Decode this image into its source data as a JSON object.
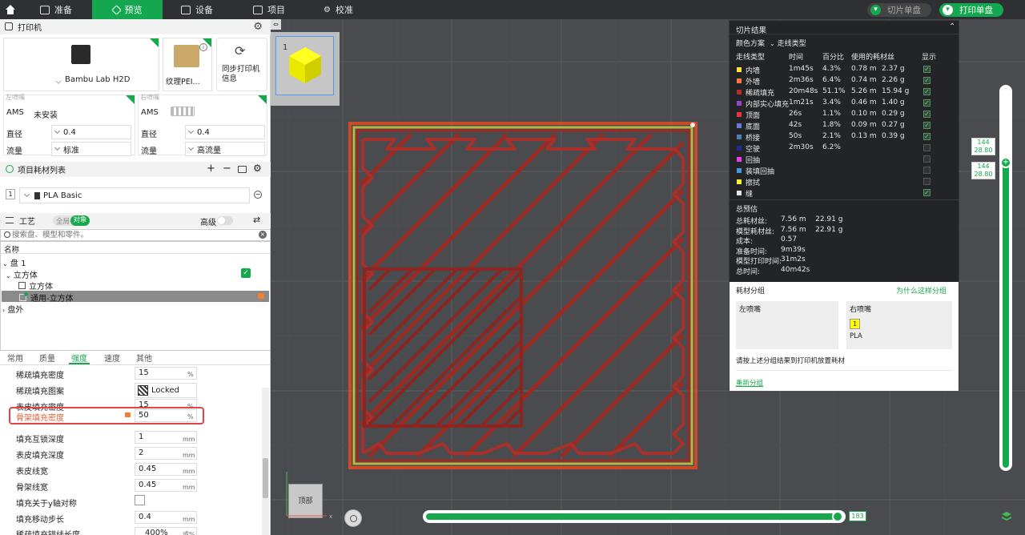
{
  "topbar": {
    "tabs": [
      {
        "label": "准备",
        "icon": "prepare-icon"
      },
      {
        "label": "预览",
        "icon": "preview-icon",
        "active": true
      },
      {
        "label": "设备",
        "icon": "device-icon"
      },
      {
        "label": "项目",
        "icon": "project-icon"
      },
      {
        "label": "校准",
        "icon": "calibrate-icon"
      }
    ],
    "slice_button": "切片单盘",
    "print_button": "打印单盘",
    "accent": "#15a750"
  },
  "printer": {
    "header": "打印机",
    "model": "Bambu Lab H2D",
    "plate": "纹理PEI...",
    "sync_label": "同步打印机信息",
    "left_nozzle_label": "左喷嘴",
    "right_nozzle_label": "右喷嘴",
    "left": {
      "ams_label": "AMS",
      "ams_value": "未安装",
      "diameter_label": "直径",
      "diameter": "0.4",
      "flow_label": "流量",
      "flow": "标准"
    },
    "right": {
      "ams_label": "AMS",
      "diameter_label": "直径",
      "diameter": "0.4",
      "flow_label": "流量",
      "flow": "高流量"
    }
  },
  "filaments": {
    "header": "项目耗材列表",
    "items": [
      {
        "index": "1",
        "name": "PLA Basic",
        "color": "#ffff00"
      }
    ]
  },
  "process": {
    "header": "工艺",
    "toggle_global": "全局",
    "toggle_object": "对象",
    "advanced_label": "高级",
    "search_placeholder": "搜索盘、模型和零件。",
    "tree_header": "名称",
    "tree": [
      {
        "label": "盘 1"
      },
      {
        "label": "立方体"
      },
      {
        "label": "立方体"
      },
      {
        "label": "通用-立方体"
      },
      {
        "label": "盘外"
      }
    ],
    "tabs": [
      "常用",
      "质量",
      "强度",
      "速度",
      "其他"
    ],
    "active_tab": "强度",
    "settings": [
      {
        "label": "稀疏填充密度",
        "value": "15",
        "unit": "%"
      },
      {
        "label": "稀疏填充图案",
        "value": "Locked Zag",
        "unit": ""
      },
      {
        "label": "表皮填充密度",
        "value": "15",
        "unit": "%"
      },
      {
        "label": "骨架填充密度",
        "value": "50",
        "unit": "%",
        "highlight": true
      },
      {
        "label": "填充互锁深度",
        "value": "1",
        "unit": "mm"
      },
      {
        "label": "表皮填充深度",
        "value": "2",
        "unit": "mm"
      },
      {
        "label": "表皮线宽",
        "value": "0.45",
        "unit": "mm"
      },
      {
        "label": "骨架线宽",
        "value": "0.45",
        "unit": "mm"
      },
      {
        "label": "填充关于y轴对称",
        "value": "",
        "unit": ""
      },
      {
        "label": "填充移动步长",
        "value": "0.4",
        "unit": "mm"
      },
      {
        "label": "稀疏填充锚线长度",
        "value": "400%",
        "unit": "或%"
      }
    ]
  },
  "viewport": {
    "plate_thumb_index": "1",
    "view_cube_label": "顶部",
    "layer_slider": {
      "top": "144",
      "top_height": "28.80",
      "bottom": "144",
      "bottom_height": "28.80"
    },
    "move_slider_value": "183",
    "move_slider_fraction": 0.98
  },
  "results": {
    "title": "切片结果",
    "color_scheme_label": "颜色方案",
    "color_scheme_value": "走线类型",
    "columns": [
      "走线类型",
      "时间",
      "百分比",
      "使用的耗材丝",
      "显示"
    ],
    "rows": [
      {
        "name": "内墙",
        "color": "#ffe833",
        "time": "1m45s",
        "pct": "4.3%",
        "len": "0.78 m",
        "wt": "2.37 g",
        "show": true
      },
      {
        "name": "外墙",
        "color": "#ff7d38",
        "time": "2m36s",
        "pct": "6.4%",
        "len": "0.74 m",
        "wt": "2.26 g",
        "show": true
      },
      {
        "name": "稀疏填充",
        "color": "#b03029",
        "time": "20m48s",
        "pct": "51.1%",
        "len": "5.26 m",
        "wt": "15.94 g",
        "show": true
      },
      {
        "name": "内部实心填充",
        "color": "#9446c9",
        "time": "1m21s",
        "pct": "3.4%",
        "len": "0.46 m",
        "wt": "1.40 g",
        "show": true
      },
      {
        "name": "顶面",
        "color": "#f0303a",
        "time": "26s",
        "pct": "1.1%",
        "len": "0.10 m",
        "wt": "0.29 g",
        "show": true
      },
      {
        "name": "底面",
        "color": "#6a7bd9",
        "time": "42s",
        "pct": "1.8%",
        "len": "0.09 m",
        "wt": "0.27 g",
        "show": true
      },
      {
        "name": "桥接",
        "color": "#4d80ba",
        "time": "50s",
        "pct": "2.1%",
        "len": "0.13 m",
        "wt": "0.39 g",
        "show": true
      },
      {
        "name": "空驶",
        "color": "#222a9e",
        "time": "2m30s",
        "pct": "6.2%",
        "len": "",
        "wt": "",
        "show": false
      },
      {
        "name": "回抽",
        "color": "#e63df0",
        "time": "",
        "pct": "",
        "len": "",
        "wt": "",
        "show": false
      },
      {
        "name": "装填回抽",
        "color": "#3d9be6",
        "time": "",
        "pct": "",
        "len": "",
        "wt": "",
        "show": false
      },
      {
        "name": "擦拭",
        "color": "#f2f23d",
        "time": "",
        "pct": "",
        "len": "",
        "wt": "",
        "show": false
      },
      {
        "name": "缝",
        "color": "#e6e6e6",
        "time": "",
        "pct": "",
        "len": "",
        "wt": "",
        "show": true
      }
    ],
    "estimate_title": "总预估",
    "estimates": [
      {
        "label": "总耗材丝:",
        "value": "7.56 m    22.91 g"
      },
      {
        "label": "模型耗材丝:",
        "value": "7.56 m    22.91 g"
      },
      {
        "label": "成本:",
        "value": "0.57"
      },
      {
        "label": "准备时间:",
        "value": "9m39s"
      },
      {
        "label": "模型打印时间:",
        "value": "31m2s"
      },
      {
        "label": "总时间:",
        "value": "40m42s"
      }
    ],
    "group": {
      "title": "耗材分组",
      "why_link": "为什么这样分组",
      "left_nozzle": "左喷嘴",
      "right_nozzle": "右喷嘴",
      "filament_index": "1",
      "filament_name": "PLA",
      "hint": "请按上述分组结果到打印机放置耗材",
      "regroup_link": "重新分组"
    }
  }
}
